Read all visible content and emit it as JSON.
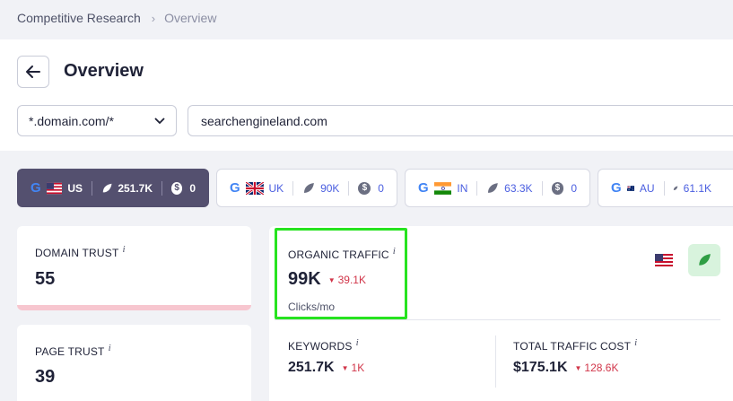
{
  "breadcrumb": {
    "root": "Competitive Research",
    "current": "Overview"
  },
  "header": {
    "title": "Overview"
  },
  "search": {
    "scope": "*.domain.com/*",
    "domain": "searchengineland.com"
  },
  "country_tabs": [
    {
      "code": "US",
      "traffic": "251.7K",
      "cost": "0",
      "active": true
    },
    {
      "code": "UK",
      "traffic": "90K",
      "cost": "0",
      "active": false
    },
    {
      "code": "IN",
      "traffic": "63.3K",
      "cost": "0",
      "active": false
    },
    {
      "code": "AU",
      "traffic": "61.1K",
      "cost": "",
      "active": false
    }
  ],
  "domain_trust": {
    "label": "DOMAIN TRUST",
    "info": "i",
    "value": "55"
  },
  "page_trust": {
    "label": "PAGE TRUST",
    "info": "i",
    "value": "39"
  },
  "organic_traffic": {
    "label": "ORGANIC TRAFFIC",
    "info": "i",
    "value": "99K",
    "delta": "39.1K",
    "unit": "Clicks/mo"
  },
  "keywords": {
    "label": "KEYWORDS",
    "info": "i",
    "value": "251.7K",
    "delta": "1K"
  },
  "traffic_cost": {
    "label": "TOTAL TRAFFIC COST",
    "info": "i",
    "value": "$175.1K",
    "delta": "128.6K"
  },
  "colors": {
    "accent": "#4a5ee0",
    "active_tab": "#54506f",
    "negative": "#d1364a",
    "highlight": "#27e320"
  }
}
